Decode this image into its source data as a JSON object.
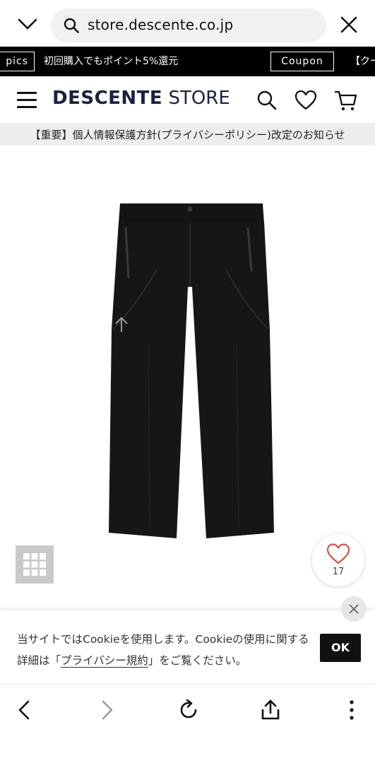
{
  "browser": {
    "url": "store.descente.co.jp",
    "icons": [
      "chevron-down-icon",
      "search-icon",
      "close-icon"
    ]
  },
  "ticker": {
    "left_pill": "pics",
    "message": "初回購入でもポイント5%還元",
    "coupon_label": "Coupon",
    "tail": "【クー"
  },
  "header": {
    "logo_bold": "DESCENTE",
    "logo_light": "STORE",
    "icons": [
      "menu-icon",
      "search-icon",
      "heart-icon",
      "cart-icon"
    ]
  },
  "notice": {
    "text": "【重要】個人情報保護方針(プライバシーポリシー)改定のお知らせ"
  },
  "product": {
    "image": "black-pants-product-image",
    "favorite_count": "17"
  },
  "cookie": {
    "text_before": "当サイトではCookieを使用します。Cookieの使用に関する詳細は「",
    "link_text": "プライバシー規約",
    "text_after": "」をご覧ください。",
    "ok_label": "OK"
  },
  "bottom_nav": {
    "icons": [
      "back-icon",
      "forward-icon",
      "reload-icon",
      "share-icon",
      "more-icon"
    ]
  },
  "colors": {
    "ticker_bg": "#000000",
    "logo": "#1c2140",
    "notice_bg": "#eeeeee",
    "favorite_heart": "#d9534f",
    "ok_button": "#111111",
    "forward_disabled": "#9a9a9a"
  }
}
